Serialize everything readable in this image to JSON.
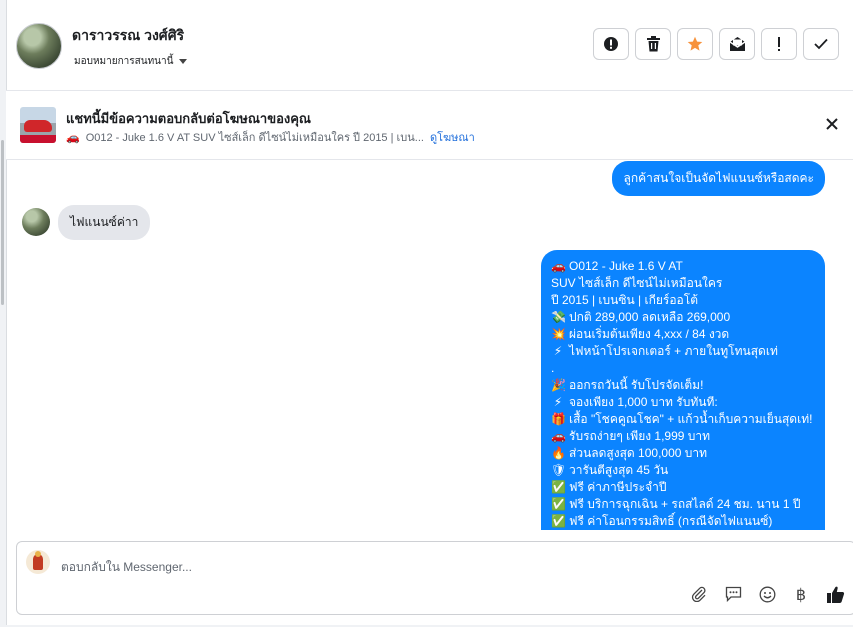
{
  "contact": {
    "name": "ดาราวรรณ วงศ์ศิริ",
    "assign_label": "มอบหมายการสนทนานี้"
  },
  "actions": [
    {
      "icon": "alert-circle-icon",
      "name": "mark-spam-button"
    },
    {
      "icon": "trash-icon",
      "name": "delete-button"
    },
    {
      "icon": "star-icon",
      "name": "star-button"
    },
    {
      "icon": "envelope-icon",
      "name": "mark-unread-button"
    },
    {
      "icon": "exclamation-icon",
      "name": "follow-up-button"
    },
    {
      "icon": "check-icon",
      "name": "mark-done-button"
    }
  ],
  "ad_reply": {
    "title": "แชทนี้มีข้อความตอบกลับต่อโฆษณาของคุณ",
    "ad_text": "O012 - Juke 1.6 V AT SUV ไซส์เล็ก ดีไซน์ไม่เหมือนใคร ปี 2015 | เบน...",
    "link_label": "ดูโฆษณา"
  },
  "messages": {
    "outgoing_1": "ลูกค้าสนใจเป็นจัดไฟแนนซ์หรือสดคะ",
    "incoming_1": "ไฟแนนซ์ค่าา",
    "outgoing_2_lines": [
      {
        "emoji": "🚗",
        "text": "O012 - Juke 1.6 V AT"
      },
      {
        "emoji": "",
        "text": "SUV ไซส์เล็ก ดีไซน์ไม่เหมือนใคร"
      },
      {
        "emoji": "",
        "text": "ปี 2015 | เบนซิน | เกียร์ออโต้"
      },
      {
        "emoji": "💸",
        "text": "ปกติ 289,000 ลดเหลือ 269,000"
      },
      {
        "emoji": "💥",
        "text": "ผ่อนเริ่มต้นเพียง 4,xxx / 84 งวด"
      },
      {
        "emoji": "⚡",
        "text": "ไฟหน้าโปรเจกเตอร์ + ภายในทูโทนสุดเท่"
      },
      {
        "emoji": "",
        "text": "."
      },
      {
        "emoji": "🎉",
        "text": "ออกรถวันนี้ รับโปรจัดเต็ม!"
      },
      {
        "emoji": "⚡",
        "text": "จองเพียง 1,000 บาท รับทันที:"
      },
      {
        "emoji": "🎁",
        "text": "เสื้อ \"โชคคูณโชค\" + แก้วน้ำเก็บความเย็นสุดเท่!"
      },
      {
        "emoji": "🚗",
        "text": "รับรถง่ายๆ เพียง 1,999 บาท"
      },
      {
        "emoji": "🔥",
        "text": "ส่วนลดสูงสุด 100,000 บาท"
      },
      {
        "emoji": "🛡",
        "text": "วารันตีสูงสุด 45 วัน"
      },
      {
        "emoji": "✅",
        "text": "ฟรี ค่าภาษีประจำปี"
      },
      {
        "emoji": "✅",
        "text": "ฟรี บริการฉุกเฉิน + รถสไลด์ 24 ชม. นาน 1 ปี"
      },
      {
        "emoji": "✅",
        "text": "ฟรี ค่าโอนกรรมสิทธิ์ (กรณีจัดไฟแนนซ์)"
      }
    ]
  },
  "composer": {
    "placeholder": "ตอบกลับใน Messenger..."
  },
  "tools": [
    "paperclip-icon",
    "saved-reply-icon",
    "emoji-icon",
    "baht-icon",
    "thumbs-up-icon"
  ],
  "colors": {
    "outgoing_bubble": "#0b84ff",
    "incoming_bubble": "#e4e6eb",
    "star": "#f7923b",
    "link": "#216fdb"
  }
}
